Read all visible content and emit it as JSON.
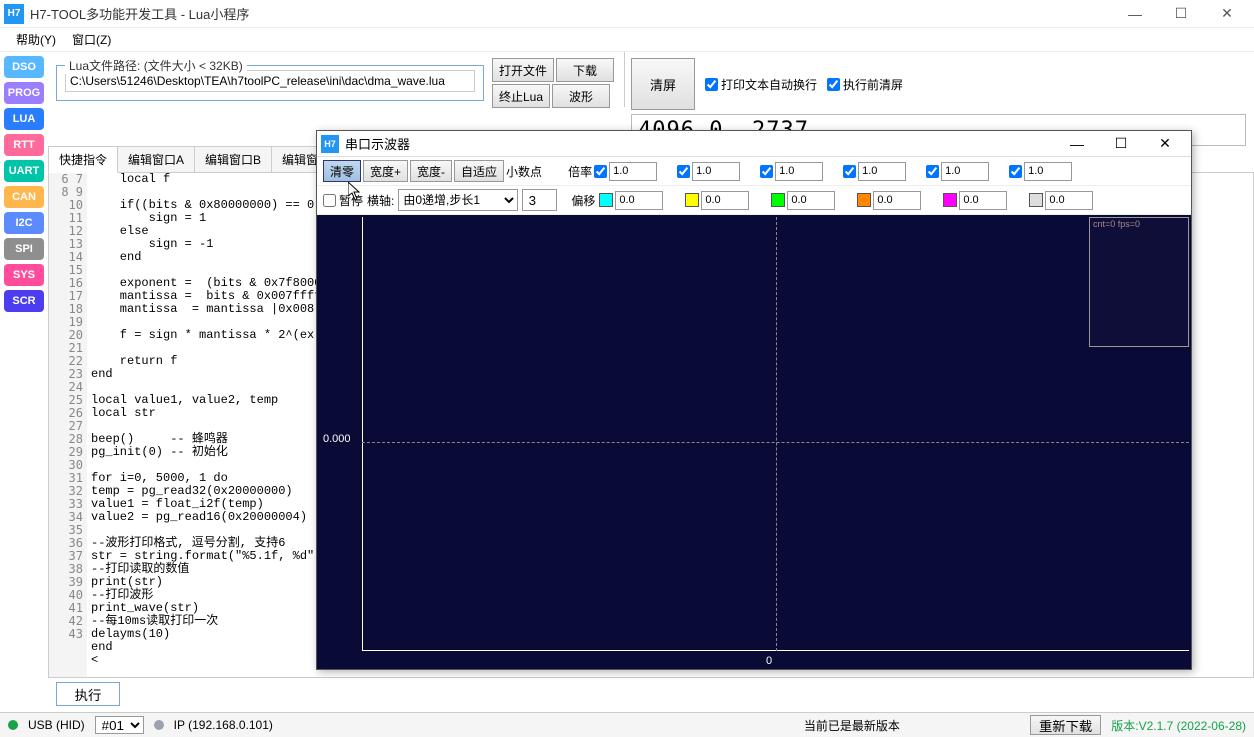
{
  "window": {
    "icon": "H7",
    "title": "H7-TOOL多功能开发工具 - Lua小程序"
  },
  "menu": {
    "help": "帮助(Y)",
    "window": "窗口(Z)"
  },
  "sidebar_buttons": [
    {
      "label": "DSO",
      "bg": "#57b7ff"
    },
    {
      "label": "PROG",
      "bg": "#9b7dff"
    },
    {
      "label": "LUA",
      "bg": "#2b7dff"
    },
    {
      "label": "RTT",
      "bg": "#ff6a9b"
    },
    {
      "label": "UART",
      "bg": "#00c4a7"
    },
    {
      "label": "CAN",
      "bg": "#ffb74d"
    },
    {
      "label": "I2C",
      "bg": "#5b8bff"
    },
    {
      "label": "SPI",
      "bg": "#8e8e8e"
    },
    {
      "label": "SYS",
      "bg": "#ff4d9b"
    },
    {
      "label": "SCR",
      "bg": "#4c3df0"
    }
  ],
  "filebar": {
    "frame_label": "Lua文件路径:  (文件大小 < 32KB)",
    "path": "C:\\Users\\51246\\Desktop\\TEA\\h7toolPC_release\\ini\\dac\\dma_wave.lua",
    "open": "打开文件",
    "download": "下载",
    "stop": "终止Lua",
    "wave": "波形"
  },
  "topright": {
    "clear": "清屏",
    "autowrap": "打印文本自动换行",
    "clear_before_run": "执行前清屏",
    "output": "4096.0, 2737"
  },
  "tabs": [
    "快捷指令",
    "编辑窗口A",
    "编辑窗口B",
    "编辑窗口C"
  ],
  "code_start_line": 6,
  "code_lines": [
    "    local f",
    "",
    "    if((bits & 0x80000000) == 0)",
    "        sign = 1",
    "    else",
    "        sign = -1",
    "    end",
    "",
    "    exponent =  (bits & 0x7f8000",
    "    mantissa =  bits & 0x007ffff",
    "    mantissa  = mantissa |0x008",
    "",
    "    f = sign * mantissa * 2^(ex",
    "",
    "    return f",
    "end",
    "",
    "local value1, value2, temp",
    "local str",
    "",
    "beep()     -- 蜂鸣器",
    "pg_init(0) -- 初始化",
    "",
    "for i=0, 5000, 1 do",
    "temp = pg_read32(0x20000000)",
    "value1 = float_i2f(temp)",
    "value2 = pg_read16(0x20000004)",
    "",
    "--波形打印格式, 逗号分割, 支持6",
    "str = string.format(\"%5.1f, %d\"",
    "--打印读取的数值",
    "print(str)",
    "--打印波形",
    "print_wave(str)",
    "--每10ms读取打印一次",
    "delayms(10)",
    "end",
    "<"
  ],
  "exec": "执行",
  "status": {
    "usb": "USB (HID)",
    "id": "#01",
    "ip": "IP (192.168.0.101)",
    "latest": "当前已是最新版本",
    "redownload": "重新下载",
    "version": "版本:V2.1.7  (2022-06-28)"
  },
  "osc": {
    "icon": "H7",
    "title": "串口示波器",
    "btn": {
      "zero": "清零",
      "hplus": "宽度+",
      "hminus": "宽度-",
      "auto": "自适应"
    },
    "decimal_label": "小数点",
    "rate_label": "倍率",
    "pause": "暂停",
    "xaxis_label": "横轴:",
    "xaxis_val": "由0递增,步长1",
    "decimal_val": "3",
    "offset_label": "偏移",
    "ch_colors": [
      "#00ffff",
      "#ffff00",
      "#00ff00",
      "#ff8800",
      "#ff00ff",
      "#dddddd"
    ],
    "rate_vals": [
      "1.0",
      "1.0",
      "1.0",
      "1.0",
      "1.0",
      "1.0"
    ],
    "offset_vals": [
      "0.0",
      "0.0",
      "0.0",
      "0.0",
      "0.0",
      "0.0"
    ],
    "ylabel": "0.000",
    "xlabel": "0",
    "legend_text": "cnt=0 fps=0"
  }
}
